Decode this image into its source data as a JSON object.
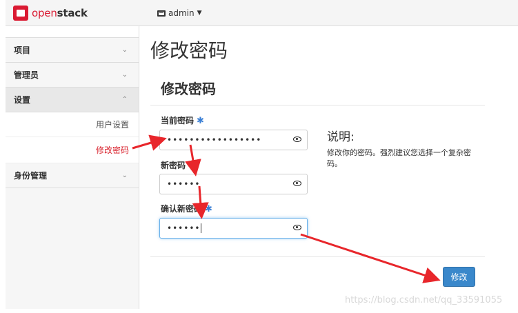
{
  "header": {
    "brand_prefix": "open",
    "brand_suffix": "stack",
    "project_menu": "admin"
  },
  "sidebar": {
    "items": [
      {
        "label": "项目"
      },
      {
        "label": "管理员"
      },
      {
        "label": "设置"
      },
      {
        "label": "身份管理"
      }
    ],
    "settings_sub": [
      {
        "label": "用户设置"
      },
      {
        "label": "修改密码"
      }
    ]
  },
  "main": {
    "page_title": "修改密码",
    "panel_title": "修改密码",
    "fields": {
      "current_label": "当前密码",
      "current_value": "•••••••••••••••••",
      "new_label": "新密码",
      "new_value": "••••••",
      "confirm_label": "确认新密码",
      "confirm_value": "••••••"
    },
    "required_mark": "✱",
    "description_title": "说明:",
    "description_text": "修改你的密码。强烈建议您选择一个复杂密码。",
    "submit_label": "修改"
  },
  "watermark": "https://blog.csdn.net/qq_33591055",
  "colors": {
    "brand_red": "#da1a32",
    "active_link": "#d9232e",
    "primary_button": "#3a88cb",
    "annotation_arrow": "#e8262b"
  }
}
